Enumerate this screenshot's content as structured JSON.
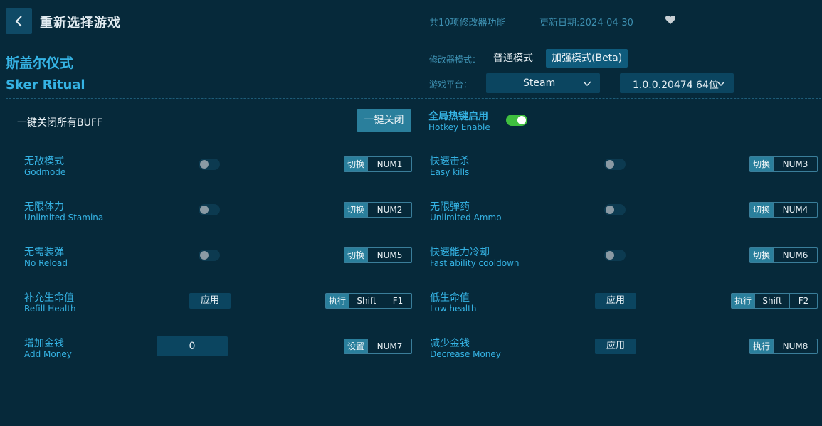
{
  "header": {
    "title": "重新选择游戏",
    "features_count": "共10项修改器功能",
    "update_date": "更新日期:2024-04-30"
  },
  "game": {
    "name_cn": "斯盖尔仪式",
    "name_en": "Sker Ritual"
  },
  "mode": {
    "label": "修改器模式：",
    "normal": "普通模式",
    "enhanced": "加强模式(Beta)"
  },
  "platform": {
    "label": "游戏平台：",
    "selected": "Steam",
    "version": "1.0.0.20474 64位"
  },
  "buff": {
    "label": "一键关闭所有BUFF",
    "button": "一键关闭"
  },
  "hotkey": {
    "label_cn": "全局热键启用",
    "label_en": "Hotkey Enable",
    "enabled": true
  },
  "features": {
    "godmode": {
      "cn": "无敌模式",
      "en": "Godmode",
      "action": "切换",
      "keys": [
        "NUM1"
      ],
      "state": false
    },
    "easykills": {
      "cn": "快速击杀",
      "en": "Easy kills",
      "action": "切换",
      "keys": [
        "NUM3"
      ],
      "state": false
    },
    "stamina": {
      "cn": "无限体力",
      "en": "Unlimited Stamina",
      "action": "切换",
      "keys": [
        "NUM2"
      ],
      "state": false
    },
    "ammo": {
      "cn": "无限弹药",
      "en": "Unlimited Ammo",
      "action": "切换",
      "keys": [
        "NUM4"
      ],
      "state": false
    },
    "noreload": {
      "cn": "无需装弹",
      "en": "No Reload",
      "action": "切换",
      "keys": [
        "NUM5"
      ],
      "state": false
    },
    "cooldown": {
      "cn": "快速能力冷却",
      "en": "Fast ability cooldown",
      "action": "切换",
      "keys": [
        "NUM6"
      ],
      "state": false
    },
    "refill": {
      "cn": "补充生命值",
      "en": "Refill Health",
      "action": "执行",
      "keys": [
        "Shift",
        "F1"
      ],
      "button": "应用"
    },
    "lowhealth": {
      "cn": "低生命值",
      "en": "Low health",
      "action": "执行",
      "keys": [
        "Shift",
        "F2"
      ],
      "button": "应用"
    },
    "addmoney": {
      "cn": "增加金钱",
      "en": "Add Money",
      "action": "设置",
      "keys": [
        "NUM7"
      ],
      "value": "0"
    },
    "decmoney": {
      "cn": "减少金钱",
      "en": "Decrease Money",
      "action": "执行",
      "keys": [
        "NUM8"
      ],
      "button": "应用"
    }
  },
  "colors": {
    "background": "#06293a",
    "accent": "#35b3e4",
    "button": "#2a7f9c",
    "toggle_on": "#3fbf3f"
  }
}
